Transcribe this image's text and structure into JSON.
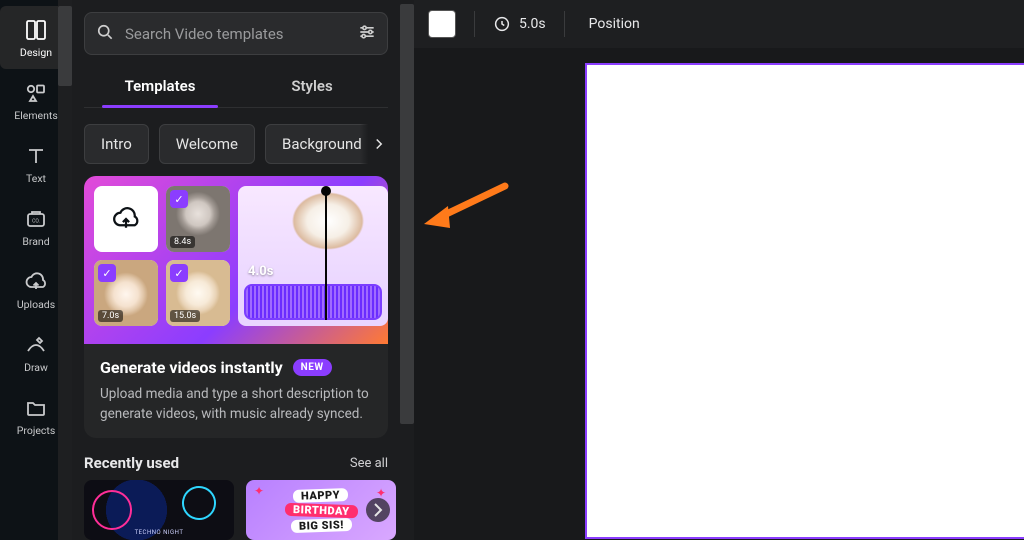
{
  "rail": {
    "items": [
      {
        "label": "Design"
      },
      {
        "label": "Elements"
      },
      {
        "label": "Text"
      },
      {
        "label": "Brand"
      },
      {
        "label": "Uploads"
      },
      {
        "label": "Draw"
      },
      {
        "label": "Projects"
      }
    ]
  },
  "panel": {
    "search_placeholder": "Search Video templates",
    "tabs": [
      {
        "label": "Templates"
      },
      {
        "label": "Styles"
      }
    ],
    "chips": [
      {
        "label": "Intro"
      },
      {
        "label": "Welcome"
      },
      {
        "label": "Background"
      }
    ],
    "promo": {
      "title": "Generate videos instantly",
      "new_badge": "NEW",
      "description": "Upload media and type a short description to generate videos, with music already synced.",
      "big_thumb_duration": "4.0s",
      "thumb_durations": [
        "",
        "8.4s",
        "7.0s",
        "15.0s"
      ]
    },
    "recent": {
      "title": "Recently used",
      "see_all": "See all",
      "items": [
        {
          "caption": "TECHNO NIGHT"
        },
        {
          "line1": "HAPPY",
          "line2": "BIRTHDAY",
          "line3": "BIG SIS!"
        }
      ]
    }
  },
  "toolbar": {
    "duration": "5.0s",
    "position": "Position"
  },
  "colors": {
    "accent": "#8b3dff",
    "annotation": "#ff7a1a"
  }
}
